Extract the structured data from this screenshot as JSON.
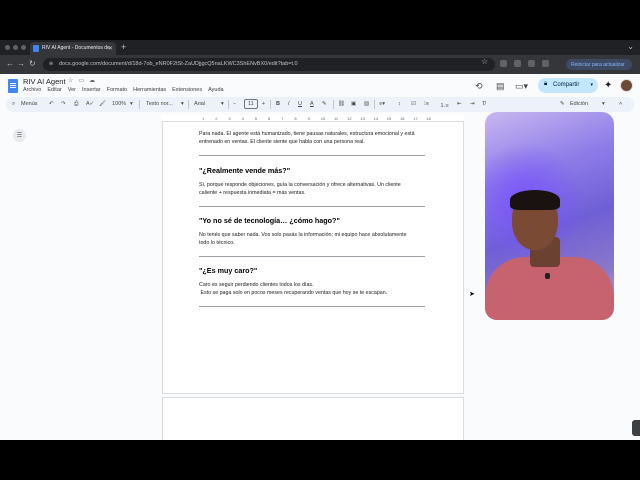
{
  "browser": {
    "tab_title": "RIV AI Agent - Documentos de",
    "url": "docs.google.com/document/d/18d-7ob_eNR0F2tSt-ZaUDjjgcQ5naLKWC3ShENvBX0/edit?tab=t.0",
    "update_label": "Reiniciar para actualizar"
  },
  "docs": {
    "title": "RIV AI Agent",
    "menu": [
      "Archivo",
      "Editar",
      "Ver",
      "Insertar",
      "Formato",
      "Herramientas",
      "Extensiones",
      "Ayuda"
    ],
    "share_label": "Compartir",
    "toolbar": {
      "search_menus": "Menús",
      "zoom": "100%",
      "style": "Texto nor...",
      "font": "Arial",
      "font_size": "11",
      "mode": "Edición"
    },
    "ruler_numbers": [
      "1",
      "2",
      "3",
      "4",
      "5",
      "6",
      "7",
      "8",
      "9",
      "10",
      "11",
      "12",
      "13",
      "14",
      "15",
      "16",
      "17",
      "18"
    ]
  },
  "document": {
    "intro_line1": "Para nada. El agente está humanizado, tiene pausas naturales, estructura emocional y está",
    "intro_line2": "entrenado en ventas. El cliente siente que habla con una persona real.",
    "sections": [
      {
        "heading": "\"¿Realmente vende más?\"",
        "line1": "Sí, porque responde objeciones, guía la conversación y ofrece alternativas. Un cliente",
        "line2": "caliente + respuesta inmediata = más ventas."
      },
      {
        "heading": "\"Yo no sé de tecnología… ¿cómo hago?\"",
        "line1": "No tenés que saber nada. Vos solo pasás la información; mi equipo hace absolutamente",
        "line2": "todo lo técnico."
      },
      {
        "heading": "\"¿Es muy caro?\"",
        "line1": "Caro es seguir perdiendo clientes todos los días.",
        "line2": " Esto se paga solo en pocos meses recuperando ventas que hoy se te escapan."
      }
    ]
  },
  "colors": {
    "share_bg": "#c2e7ff",
    "docs_blue": "#4285f4",
    "toolbar_bg": "#edf2fa"
  }
}
